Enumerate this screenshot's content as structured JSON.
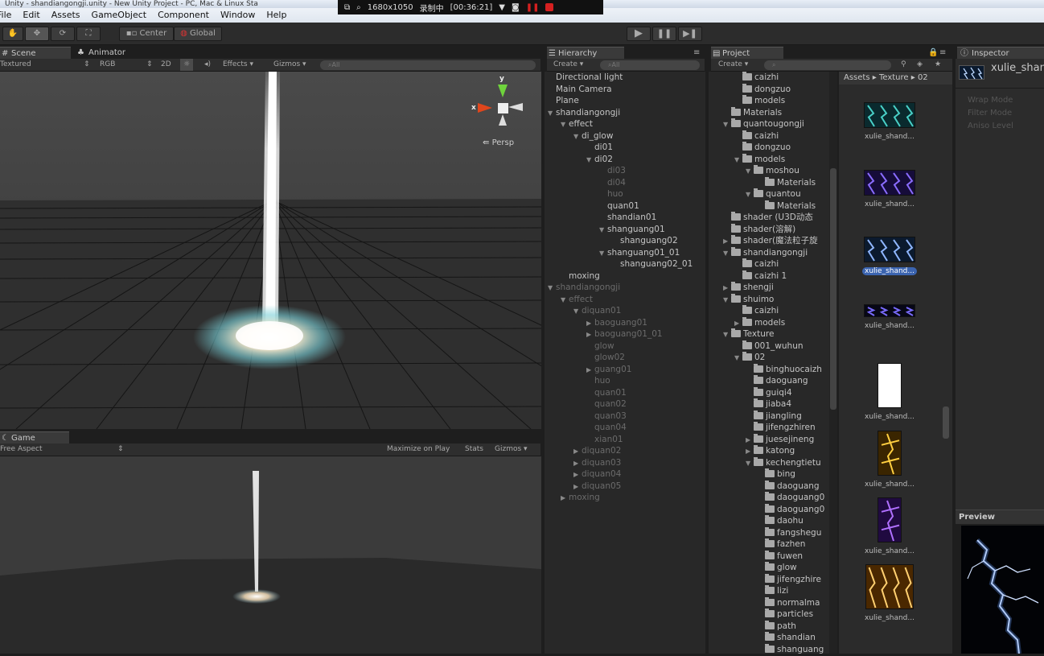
{
  "window": {
    "title": "Unity - shandiangongji.unity - New Unity Project - PC, Mac & Linux Sta"
  },
  "recorder": {
    "resolution": "1680x1050",
    "status": "录制中",
    "time": "[00:36:21]"
  },
  "menu": [
    "File",
    "Edit",
    "Assets",
    "GameObject",
    "Component",
    "Window",
    "Help"
  ],
  "toolbar": {
    "center": "Center",
    "global": "Global"
  },
  "scene": {
    "tab": "Scene",
    "tab2": "Animator",
    "shading": "Textured",
    "render": "RGB",
    "mode2d": "2D",
    "effects": "Effects",
    "gizmos": "Gizmos",
    "search": "All",
    "gizmo_y": "y",
    "gizmo_x": "x",
    "persp": "Persp"
  },
  "game": {
    "tab": "Game",
    "aspect": "Free Aspect",
    "maximize": "Maximize on Play",
    "stats": "Stats",
    "gizmos": "Gizmos"
  },
  "hierarchy": {
    "tab": "Hierarchy",
    "create": "Create",
    "search": "All",
    "items": [
      {
        "label": "Directional light",
        "indent": 0,
        "arrow": "",
        "dim": false
      },
      {
        "label": "Main Camera",
        "indent": 0,
        "arrow": "",
        "dim": false
      },
      {
        "label": "Plane",
        "indent": 0,
        "arrow": "",
        "dim": false
      },
      {
        "label": "shandiangongji",
        "indent": 0,
        "arrow": "▼",
        "dim": false
      },
      {
        "label": "effect",
        "indent": 1,
        "arrow": "▼",
        "dim": false
      },
      {
        "label": "di_glow",
        "indent": 2,
        "arrow": "▼",
        "dim": false
      },
      {
        "label": "di01",
        "indent": 3,
        "arrow": "",
        "dim": false
      },
      {
        "label": "di02",
        "indent": 3,
        "arrow": "▼",
        "dim": false
      },
      {
        "label": "di03",
        "indent": 4,
        "arrow": "",
        "dim": true
      },
      {
        "label": "di04",
        "indent": 4,
        "arrow": "",
        "dim": true
      },
      {
        "label": "huo",
        "indent": 4,
        "arrow": "",
        "dim": true
      },
      {
        "label": "quan01",
        "indent": 4,
        "arrow": "",
        "dim": false
      },
      {
        "label": "shandian01",
        "indent": 4,
        "arrow": "",
        "dim": false
      },
      {
        "label": "shanguang01",
        "indent": 4,
        "arrow": "▼",
        "dim": false
      },
      {
        "label": "shanguang02",
        "indent": 5,
        "arrow": "",
        "dim": false
      },
      {
        "label": "shanguang01_01",
        "indent": 4,
        "arrow": "▼",
        "dim": false
      },
      {
        "label": "shanguang02_01",
        "indent": 5,
        "arrow": "",
        "dim": false
      },
      {
        "label": "moxing",
        "indent": 1,
        "arrow": "",
        "dim": false
      },
      {
        "label": "shandiangongji",
        "indent": 0,
        "arrow": "▼",
        "dim": true
      },
      {
        "label": "effect",
        "indent": 1,
        "arrow": "▼",
        "dim": true
      },
      {
        "label": "diquan01",
        "indent": 2,
        "arrow": "▼",
        "dim": true
      },
      {
        "label": "baoguang01",
        "indent": 3,
        "arrow": "▶",
        "dim": true
      },
      {
        "label": "baoguang01_01",
        "indent": 3,
        "arrow": "▶",
        "dim": true
      },
      {
        "label": "glow",
        "indent": 3,
        "arrow": "",
        "dim": true
      },
      {
        "label": "glow02",
        "indent": 3,
        "arrow": "",
        "dim": true
      },
      {
        "label": "guang01",
        "indent": 3,
        "arrow": "▶",
        "dim": true
      },
      {
        "label": "huo",
        "indent": 3,
        "arrow": "",
        "dim": true
      },
      {
        "label": "quan01",
        "indent": 3,
        "arrow": "",
        "dim": true
      },
      {
        "label": "quan02",
        "indent": 3,
        "arrow": "",
        "dim": true
      },
      {
        "label": "quan03",
        "indent": 3,
        "arrow": "",
        "dim": true
      },
      {
        "label": "quan04",
        "indent": 3,
        "arrow": "",
        "dim": true
      },
      {
        "label": "xian01",
        "indent": 3,
        "arrow": "",
        "dim": true
      },
      {
        "label": "diquan02",
        "indent": 2,
        "arrow": "▶",
        "dim": true
      },
      {
        "label": "diquan03",
        "indent": 2,
        "arrow": "▶",
        "dim": true
      },
      {
        "label": "diquan04",
        "indent": 2,
        "arrow": "▶",
        "dim": true
      },
      {
        "label": "diquan05",
        "indent": 2,
        "arrow": "▶",
        "dim": true
      },
      {
        "label": "moxing",
        "indent": 1,
        "arrow": "▶",
        "dim": true
      }
    ]
  },
  "project": {
    "tab": "Project",
    "create": "Create",
    "breadcrumb": [
      "Assets",
      "Texture",
      "02"
    ],
    "tree": [
      {
        "label": "caizhi",
        "indent": 2,
        "arrow": ""
      },
      {
        "label": "dongzuo",
        "indent": 2,
        "arrow": ""
      },
      {
        "label": "models",
        "indent": 2,
        "arrow": ""
      },
      {
        "label": "Materials",
        "indent": 1,
        "arrow": ""
      },
      {
        "label": "quantougongji",
        "indent": 1,
        "arrow": "▼"
      },
      {
        "label": "caizhi",
        "indent": 2,
        "arrow": ""
      },
      {
        "label": "dongzuo",
        "indent": 2,
        "arrow": ""
      },
      {
        "label": "models",
        "indent": 2,
        "arrow": "▼"
      },
      {
        "label": "moshou",
        "indent": 3,
        "arrow": "▼"
      },
      {
        "label": "Materials",
        "indent": 4,
        "arrow": ""
      },
      {
        "label": "quantou",
        "indent": 3,
        "arrow": "▼"
      },
      {
        "label": "Materials",
        "indent": 4,
        "arrow": ""
      },
      {
        "label": "shader (U3D动态",
        "indent": 1,
        "arrow": ""
      },
      {
        "label": "shader(溶解)",
        "indent": 1,
        "arrow": ""
      },
      {
        "label": "shader(魔法粒子旋",
        "indent": 1,
        "arrow": "▶"
      },
      {
        "label": "shandiangongji",
        "indent": 1,
        "arrow": "▼"
      },
      {
        "label": "caizhi",
        "indent": 2,
        "arrow": ""
      },
      {
        "label": "caizhi 1",
        "indent": 2,
        "arrow": ""
      },
      {
        "label": "shengji",
        "indent": 1,
        "arrow": "▶"
      },
      {
        "label": "shuimo",
        "indent": 1,
        "arrow": "▼"
      },
      {
        "label": "caizhi",
        "indent": 2,
        "arrow": ""
      },
      {
        "label": "models",
        "indent": 2,
        "arrow": "▶"
      },
      {
        "label": "Texture",
        "indent": 1,
        "arrow": "▼"
      },
      {
        "label": "001_wuhun",
        "indent": 2,
        "arrow": ""
      },
      {
        "label": "02",
        "indent": 2,
        "arrow": "▼"
      },
      {
        "label": "binghuocaizh",
        "indent": 3,
        "arrow": ""
      },
      {
        "label": "daoguang",
        "indent": 3,
        "arrow": ""
      },
      {
        "label": "guiqi4",
        "indent": 3,
        "arrow": ""
      },
      {
        "label": "jiaba4",
        "indent": 3,
        "arrow": ""
      },
      {
        "label": "jiangling",
        "indent": 3,
        "arrow": ""
      },
      {
        "label": "jifengzhiren",
        "indent": 3,
        "arrow": ""
      },
      {
        "label": "juesejineng",
        "indent": 3,
        "arrow": "▶"
      },
      {
        "label": "katong",
        "indent": 3,
        "arrow": "▶"
      },
      {
        "label": "kechengtietu",
        "indent": 3,
        "arrow": "▼"
      },
      {
        "label": "bing",
        "indent": 4,
        "arrow": ""
      },
      {
        "label": "daoguang",
        "indent": 4,
        "arrow": ""
      },
      {
        "label": "daoguang0",
        "indent": 4,
        "arrow": ""
      },
      {
        "label": "daoguang0",
        "indent": 4,
        "arrow": ""
      },
      {
        "label": "daohu",
        "indent": 4,
        "arrow": ""
      },
      {
        "label": "fangshegu",
        "indent": 4,
        "arrow": ""
      },
      {
        "label": "fazhen",
        "indent": 4,
        "arrow": ""
      },
      {
        "label": "fuwen",
        "indent": 4,
        "arrow": ""
      },
      {
        "label": "glow",
        "indent": 4,
        "arrow": ""
      },
      {
        "label": "jifengzhire",
        "indent": 4,
        "arrow": ""
      },
      {
        "label": "lizi",
        "indent": 4,
        "arrow": ""
      },
      {
        "label": "normalma",
        "indent": 4,
        "arrow": ""
      },
      {
        "label": "particles",
        "indent": 4,
        "arrow": ""
      },
      {
        "label": "path",
        "indent": 4,
        "arrow": ""
      },
      {
        "label": "shandian",
        "indent": 4,
        "arrow": ""
      },
      {
        "label": "shanguang",
        "indent": 4,
        "arrow": ""
      }
    ],
    "assets": [
      {
        "label": "xulie_shand...",
        "color": "#49d1c8",
        "bg": "#0a2a2e",
        "selected": false
      },
      {
        "label": "xulie_shand...",
        "color": "#8a6cff",
        "bg": "#160c3a",
        "selected": false
      },
      {
        "label": "xulie_shand...",
        "color": "#8fb6ff",
        "bg": "#0b1a2e",
        "selected": true
      },
      {
        "label": "xulie_shand...",
        "color": "#7a6cff",
        "bg": "#070716",
        "selected": false
      },
      {
        "label": "xulie_shand...",
        "color": "#ffffff",
        "bg": "#ffffff",
        "selected": false
      },
      {
        "label": "xulie_shand...",
        "color": "#ffcf40",
        "bg": "#3a2500",
        "selected": false
      },
      {
        "label": "xulie_shand...",
        "color": "#b070ff",
        "bg": "#200a40",
        "selected": false
      },
      {
        "label": "xulie_shand...",
        "color": "#ffd070",
        "bg": "#4a2800",
        "selected": false
      }
    ]
  },
  "inspector": {
    "tab": "Inspector",
    "asset_name": "xulie_shan",
    "rows": [
      "Wrap Mode",
      "Filter Mode",
      "Aniso Level"
    ],
    "preview": "Preview"
  }
}
